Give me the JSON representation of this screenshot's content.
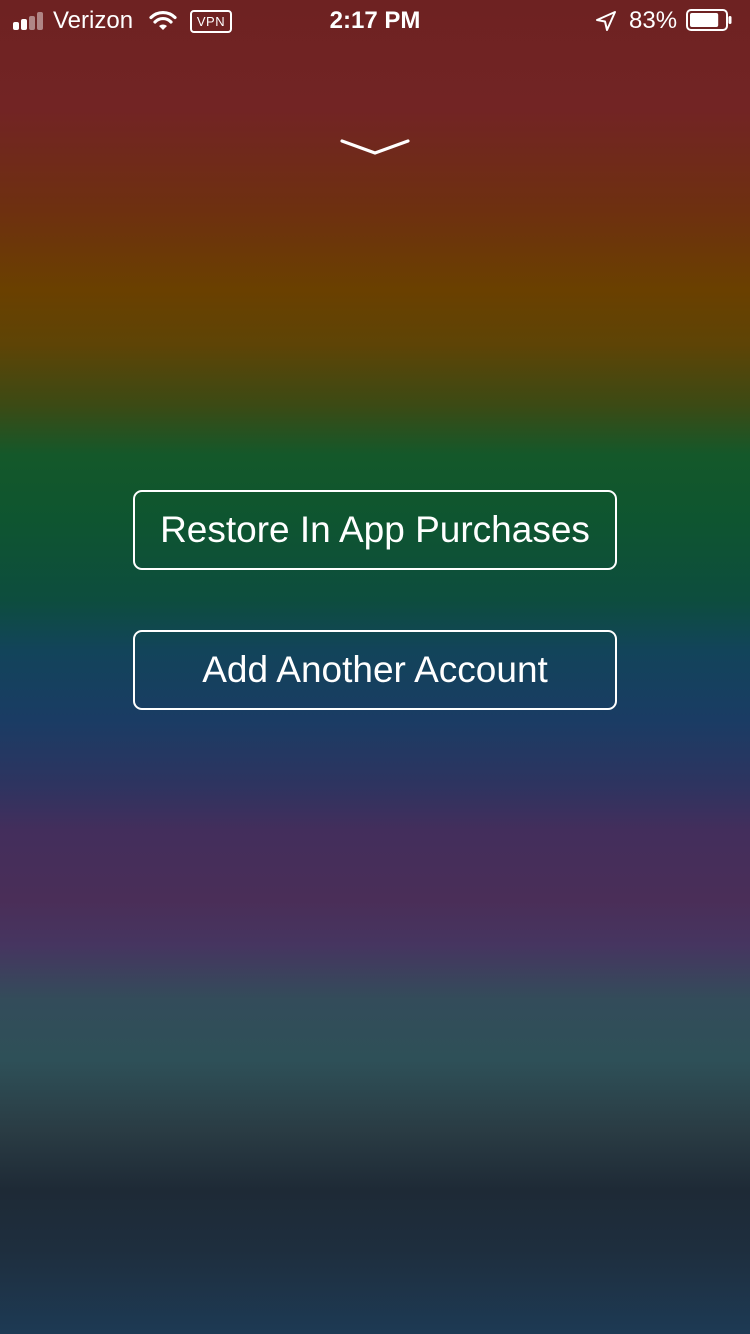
{
  "status_bar": {
    "carrier": "Verizon",
    "vpn_label": "VPN",
    "time": "2:17 PM",
    "battery_percent": "83%",
    "battery_level": 0.83,
    "signal_bars_filled": 2,
    "signal_bars_total": 4,
    "icons": [
      "signal-icon",
      "wifi-icon",
      "vpn-icon",
      "location-arrow-icon",
      "battery-icon"
    ]
  },
  "sheet": {
    "dismiss_icon": "chevron-down-icon"
  },
  "actions": {
    "restore_label": "Restore In App Purchases",
    "add_account_label": "Add Another Account"
  },
  "colors": {
    "text": "#ffffff",
    "button_border": "#ffffff"
  }
}
